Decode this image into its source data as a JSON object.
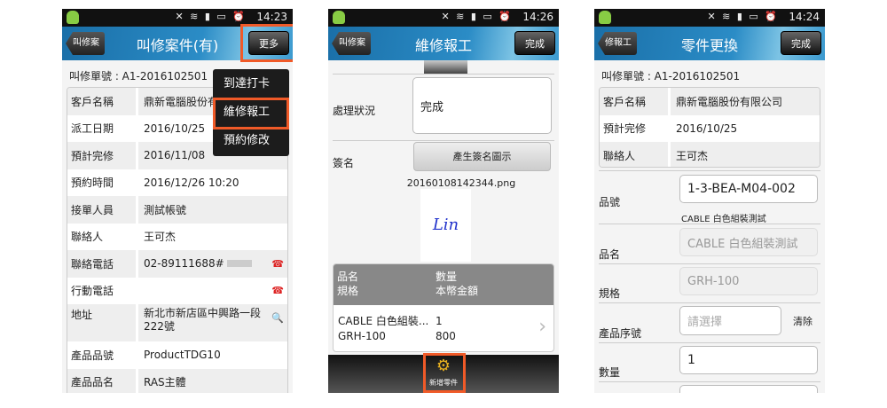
{
  "screens": [
    {
      "status_time": "14:23",
      "back_label": "叫修案",
      "title": "叫修案件(有)",
      "right_button": "更多",
      "order_no": "叫修單號 : A1-2016102501",
      "rows": [
        {
          "label": "客戶名稱",
          "value": "鼎新電腦股份有"
        },
        {
          "label": "派工日期",
          "value": "2016/10/25"
        },
        {
          "label": "預計完修",
          "value": "2016/11/08"
        },
        {
          "label": "預約時間",
          "value": "2016/12/26 10:20"
        },
        {
          "label": "接單人員",
          "value": "測試帳號"
        },
        {
          "label": "聯絡人",
          "value": "王可杰"
        },
        {
          "label": "聯絡電話",
          "value": "02-89111688#"
        },
        {
          "label": "行動電話",
          "value": ""
        },
        {
          "label": "地址",
          "value": "新北市新店區中興路一段222號"
        },
        {
          "label": "產品品號",
          "value": "ProductTDG10"
        },
        {
          "label": "產品品名",
          "value": "RAS主體"
        }
      ],
      "menu": [
        "到達打卡",
        "維修報工",
        "預約修改"
      ]
    },
    {
      "status_time": "14:26",
      "back_label": "叫修案",
      "title": "維修報工",
      "right_button": "完成",
      "status_label": "處理狀況",
      "status_value": "完成",
      "sign_label": "簽名",
      "sign_button": "產生簽名圖示",
      "sign_file": "20160108142344.png",
      "signature": "Lin",
      "parts_header": {
        "c1a": "品名",
        "c1b": "規格",
        "c2a": "數量",
        "c2b": "本幣金額"
      },
      "parts": [
        {
          "name": "CABLE 白色組裝...",
          "spec": "GRH-100",
          "qty": "1",
          "amount": "800"
        }
      ],
      "add_part": "新增零件"
    },
    {
      "status_time": "14:24",
      "back_label": "修報工",
      "title": "零件更換",
      "right_button": "完成",
      "order_no": "叫修單號 : A1-2016102501",
      "rows": [
        {
          "label": "客戶名稱",
          "value": "鼎新電腦股份有限公司"
        },
        {
          "label": "預計完修",
          "value": "2016/10/25"
        },
        {
          "label": "聯絡人",
          "value": "王可杰"
        }
      ],
      "part_no_label": "品號",
      "part_no": "1-3-BEA-M04-002",
      "part_no_desc": "CABLE 白色組裝測試",
      "name_label": "品名",
      "name": "CABLE 白色組裝測試",
      "spec_label": "規格",
      "spec": "GRH-100",
      "serial_label": "產品序號",
      "serial_placeholder": "請選擇",
      "clear": "清除",
      "qty_label": "數量",
      "qty": "1"
    }
  ],
  "colors": {
    "highlight": "#f05a28",
    "header": "#2b8cc6"
  }
}
